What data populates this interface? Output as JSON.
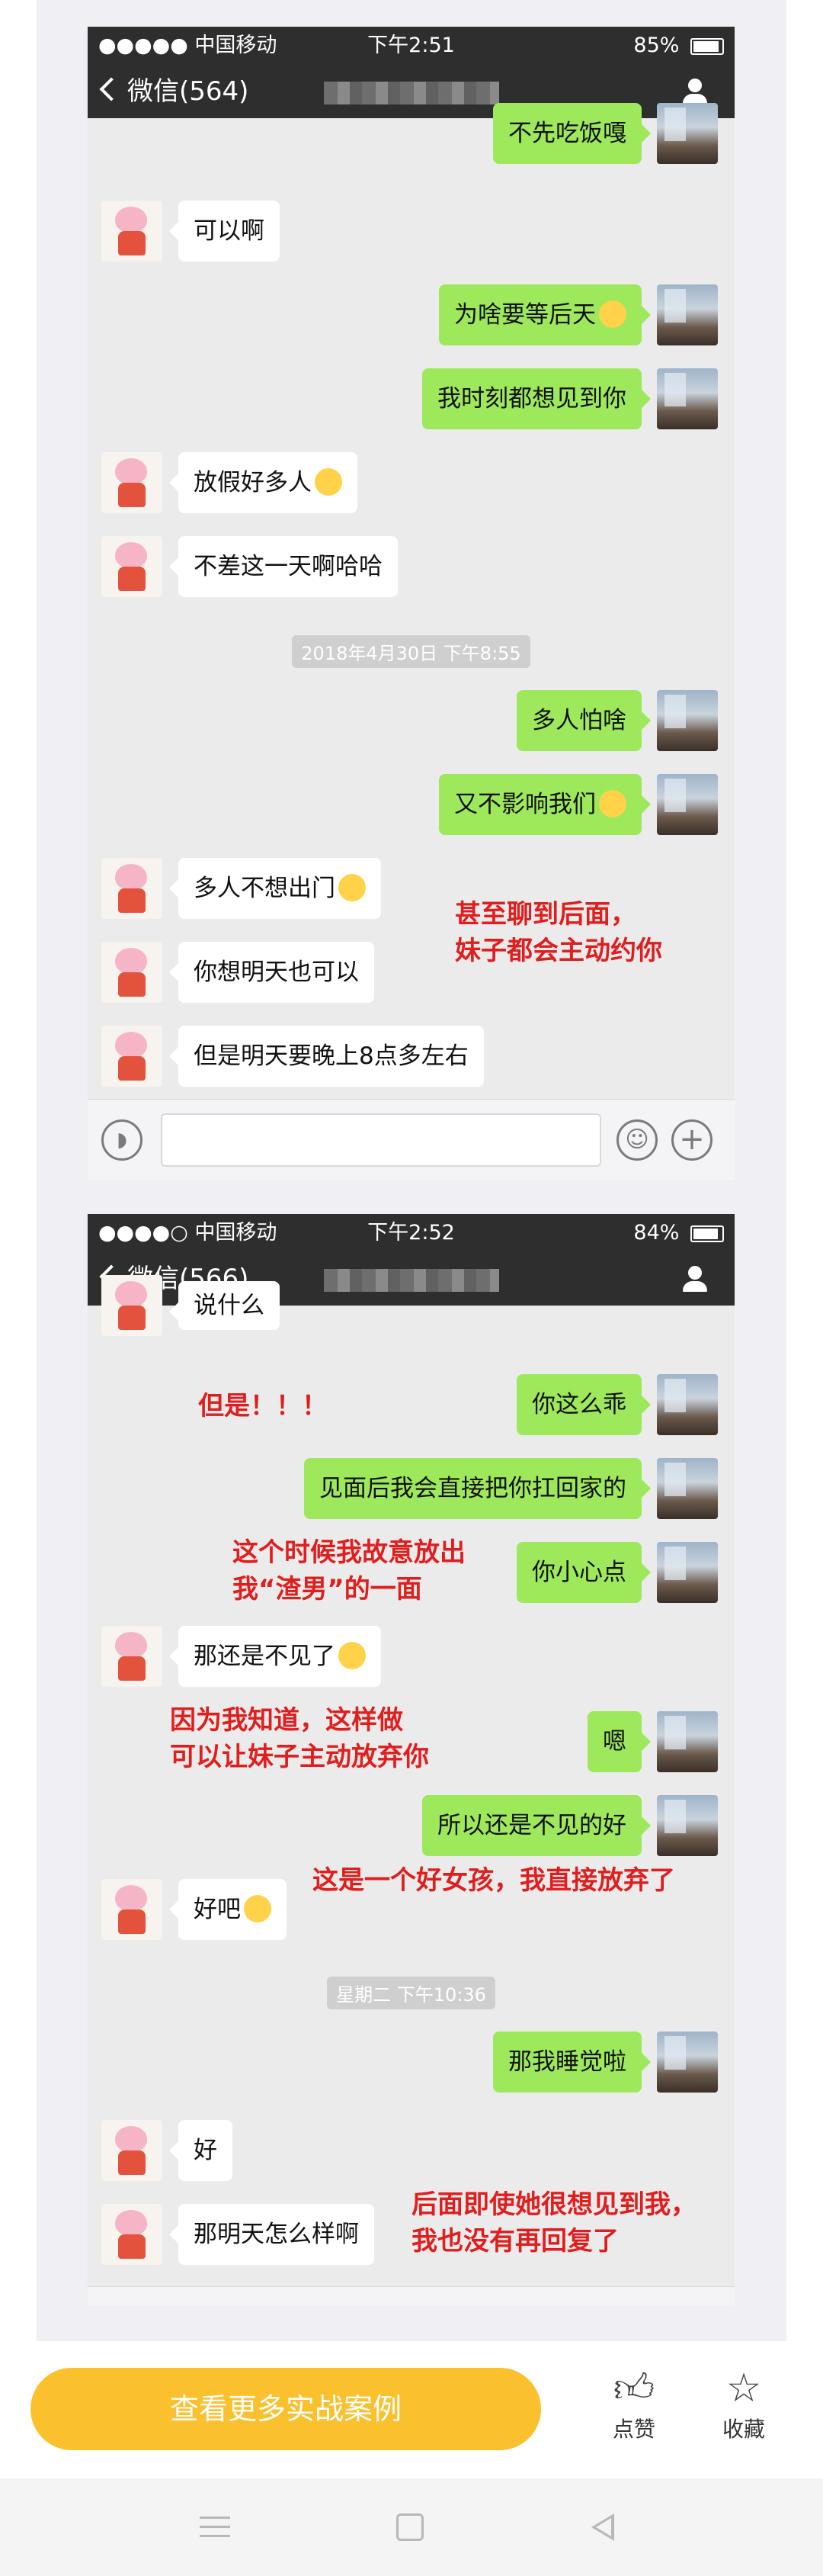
{
  "screenshot1": {
    "status": {
      "carrier": "●●●●● 中国移动 ",
      "wifi": "",
      "time": "下午2:51",
      "right": "85%",
      "battery_level": 0.85
    },
    "nav": {
      "back_label": "微信(564)"
    },
    "messages": {
      "m0": "不先吃饭嘎",
      "m1": "可以啊",
      "m2": "为啥要等后天",
      "m3": "我时刻都想见到你",
      "m4": "放假好多人",
      "m5": "不差这一天啊哈哈",
      "m6": "多人怕啥",
      "m7": "又不影响我们",
      "m8": "多人不想出门",
      "m9": "你想明天也可以",
      "m10": "但是明天要晚上8点多左右"
    },
    "timestamp": "2018年4月30日 下午8:55",
    "annotation": [
      "甚至聊到后面，",
      "妹子都会主动约你"
    ]
  },
  "screenshot2": {
    "status": {
      "carrier": "●●●●○ 中国移动 ",
      "time": "下午2:52",
      "right": "84%",
      "battery_level": 0.84
    },
    "nav": {
      "back_label": "微信(566)"
    },
    "messages": {
      "m0": "说什么",
      "m1": "你这么乖",
      "m2": "见面后我会直接把你扛回家的",
      "m3": "你小心点",
      "m4": "那还是不见了",
      "m5": "嗯",
      "m6": "所以还是不见的好",
      "m7": "好吧",
      "m8": "那我睡觉啦",
      "m9": "好",
      "m10": "那明天怎么样啊"
    },
    "timestamp": "星期二 下午10:36",
    "annotations": {
      "a1": "但是！！！",
      "a2_line1": "这个时候我故意放出",
      "a2_line2": "我“渣男”的一面",
      "a3_line1": "因为我知道，这样做",
      "a3_line2": "可以让妹子主动放弃你",
      "a4": "这是一个好女孩，我直接放弃了",
      "a5_line1": "后面即使她很想见到我，",
      "a5_line2": "我也没有再回复了"
    }
  },
  "footer": {
    "cta_label": "查看更多实战案例",
    "like_label": "点赞",
    "fav_label": "收藏",
    "like_icon": "thumbs-up-icon",
    "fav_icon": "star-icon"
  },
  "colors": {
    "cta": "#fbc02d",
    "annotation": "#e01e1e",
    "bubble_me": "#9ee85c"
  }
}
